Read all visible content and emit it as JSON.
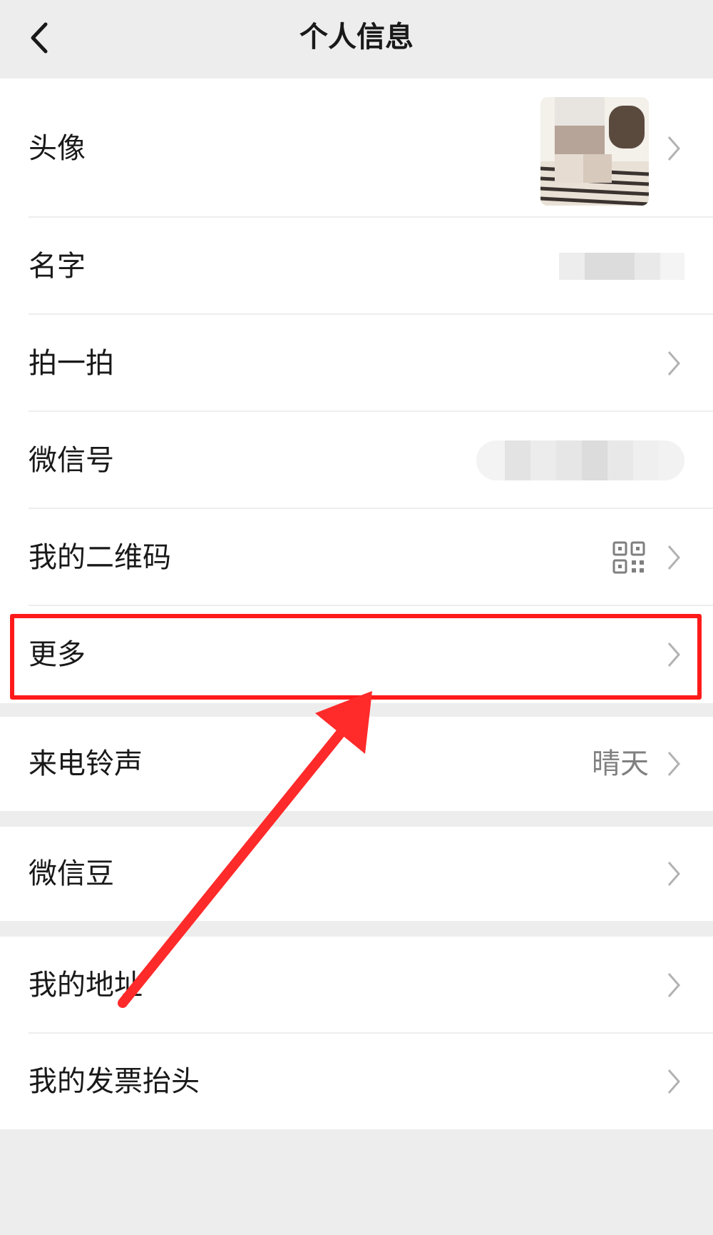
{
  "header": {
    "title": "个人信息",
    "back_icon": "chevron-left-icon"
  },
  "rows": {
    "avatar": {
      "label": "头像"
    },
    "name": {
      "label": "名字"
    },
    "pat": {
      "label": "拍一拍"
    },
    "wechat_id": {
      "label": "微信号"
    },
    "qr_code": {
      "label": "我的二维码",
      "icon": "qr-code-icon"
    },
    "more": {
      "label": "更多"
    },
    "ringtone": {
      "label": "来电铃声",
      "value": "晴天"
    },
    "wechat_beans": {
      "label": "微信豆"
    },
    "address": {
      "label": "我的地址"
    },
    "invoice": {
      "label": "我的发票抬头"
    }
  },
  "annotation": {
    "highlight_color": "#ff1a1a",
    "arrow_color": "#ff2a2a"
  },
  "colors": {
    "background": "#ededed",
    "cell": "#ffffff",
    "text": "#191919",
    "secondary_text": "#808080",
    "chevron": "#b2b2b2"
  }
}
